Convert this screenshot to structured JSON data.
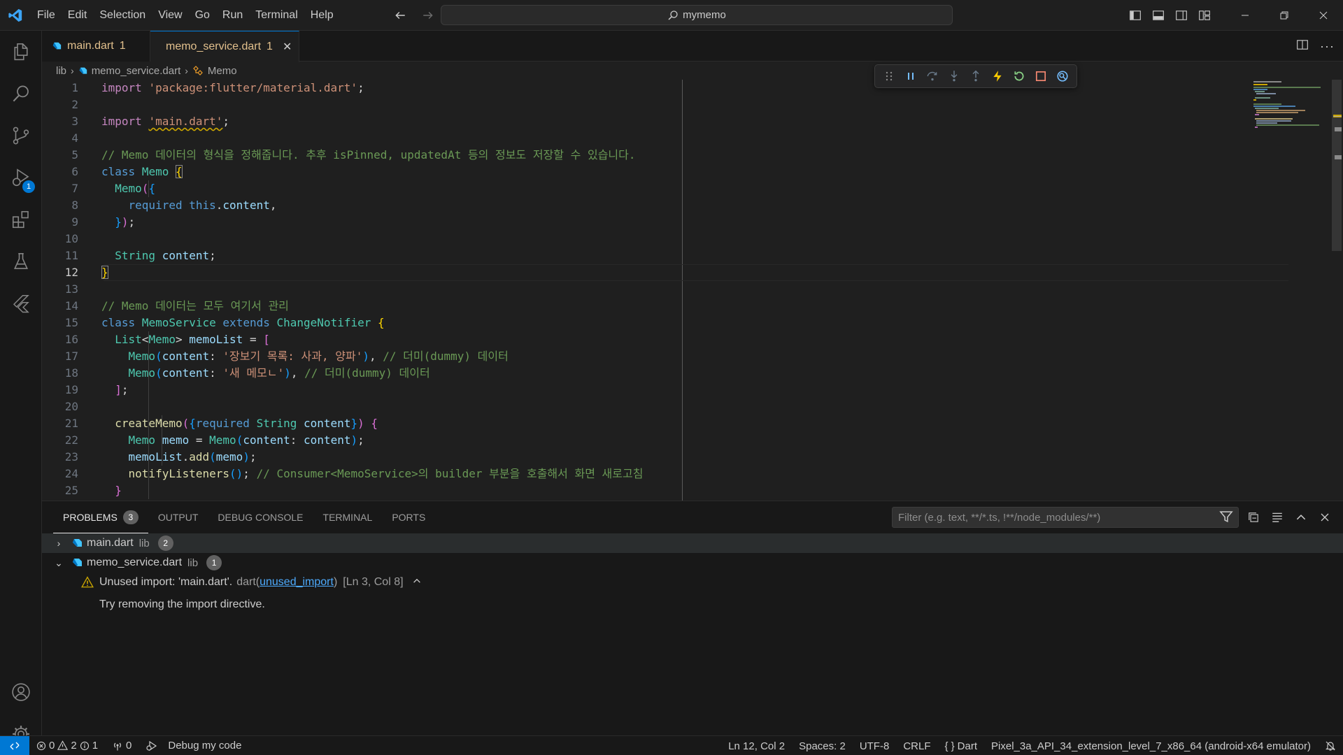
{
  "menu": [
    "File",
    "Edit",
    "Selection",
    "View",
    "Go",
    "Run",
    "Terminal",
    "Help"
  ],
  "search": {
    "label": "mymemo"
  },
  "tabs": [
    {
      "label": "main.dart",
      "problems": "1"
    },
    {
      "label": "memo_service.dart",
      "problems": "1"
    }
  ],
  "breadcrumb": {
    "folder": "lib",
    "file": "memo_service.dart",
    "symbol": "Memo"
  },
  "editor": {
    "current_line": 12,
    "line_numbers": [
      "1",
      "2",
      "3",
      "4",
      "5",
      "6",
      "7",
      "8",
      "9",
      "10",
      "11",
      "12",
      "13",
      "14",
      "15",
      "16",
      "17",
      "18",
      "19",
      "20",
      "21",
      "22",
      "23",
      "24",
      "25"
    ]
  },
  "activity": {
    "debug_badge": "1"
  },
  "panel": {
    "tabs": [
      "PROBLEMS",
      "OUTPUT",
      "DEBUG CONSOLE",
      "TERMINAL",
      "PORTS"
    ],
    "problems_count": "3",
    "filter_placeholder": "Filter (e.g. text, **/*.ts, !**/node_modules/**)",
    "files": [
      {
        "name": "main.dart",
        "dir": "lib",
        "count": "2",
        "expanded": false
      },
      {
        "name": "memo_service.dart",
        "dir": "lib",
        "count": "1",
        "expanded": true
      }
    ],
    "warning": {
      "message": "Unused import: 'main.dart'.",
      "source": "dart(",
      "code": "unused_import",
      "close": ")",
      "location": "[Ln 3, Col 8]",
      "hint": "Try removing the import directive."
    }
  },
  "status": {
    "errors": "0",
    "warnings": "2",
    "infos": "1",
    "ports": "0",
    "debug_label": "Debug my code",
    "cursor": "Ln 12, Col 2",
    "spaces": "Spaces: 2",
    "encoding": "UTF-8",
    "eol": "CRLF",
    "language": "Dart",
    "device": "Pixel_3a_API_34_extension_level_7_x86_64 (android-x64 emulator)"
  },
  "colors": {
    "accent": "#0078d4",
    "warning": "#cca700",
    "modified": "#e2c08d"
  }
}
